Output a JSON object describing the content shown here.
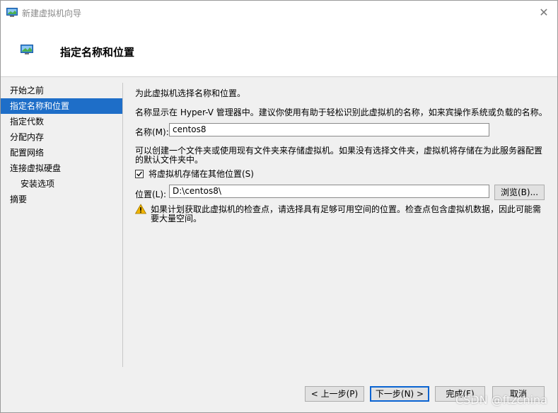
{
  "window": {
    "title": "新建虚拟机向导",
    "close_label": "✕"
  },
  "header": {
    "title": "指定名称和位置"
  },
  "nav": {
    "items": [
      {
        "label": "开始之前"
      },
      {
        "label": "指定名称和位置"
      },
      {
        "label": "指定代数"
      },
      {
        "label": "分配内存"
      },
      {
        "label": "配置网络"
      },
      {
        "label": "连接虚拟硬盘"
      },
      {
        "label": "安装选项"
      },
      {
        "label": "摘要"
      }
    ],
    "active_index": 1
  },
  "content": {
    "intro": "为此虚拟机选择名称和位置。",
    "name_hint": "名称显示在 Hyper-V 管理器中。建议你使用有助于轻松识别此虚拟机的名称，如来宾操作系统或负载的名称。",
    "name_label": "名称(M):",
    "name_value": "centos8",
    "folder_hint_line1": "可以创建一个文件夹或使用现有文件夹来存储虚拟机。如果没有选择文件夹，虚拟机将存储在为此服务器配置",
    "folder_hint_line2": "的默认文件夹中。",
    "store_checkbox_label": "将虚拟机存储在其他位置(S)",
    "store_checkbox_checked": true,
    "location_label": "位置(L):",
    "location_value": "D:\\centos8\\",
    "browse_label": "浏览(B)...",
    "warning_line1": "如果计划获取此虚拟机的检查点，请选择具有足够可用空间的位置。检查点包含虚拟机数据，因此可能需",
    "warning_line2": "要大量空间。"
  },
  "footer": {
    "prev_label": "< 上一步(P)",
    "next_label": "下一步(N) >",
    "finish_label": "完成(F)",
    "cancel_label": "取消"
  },
  "watermark": "CSDN @ftzchina",
  "colors": {
    "selection": "#1e6ec8",
    "panel_bg": "#f0f0f0",
    "warning": "#f0b400"
  }
}
